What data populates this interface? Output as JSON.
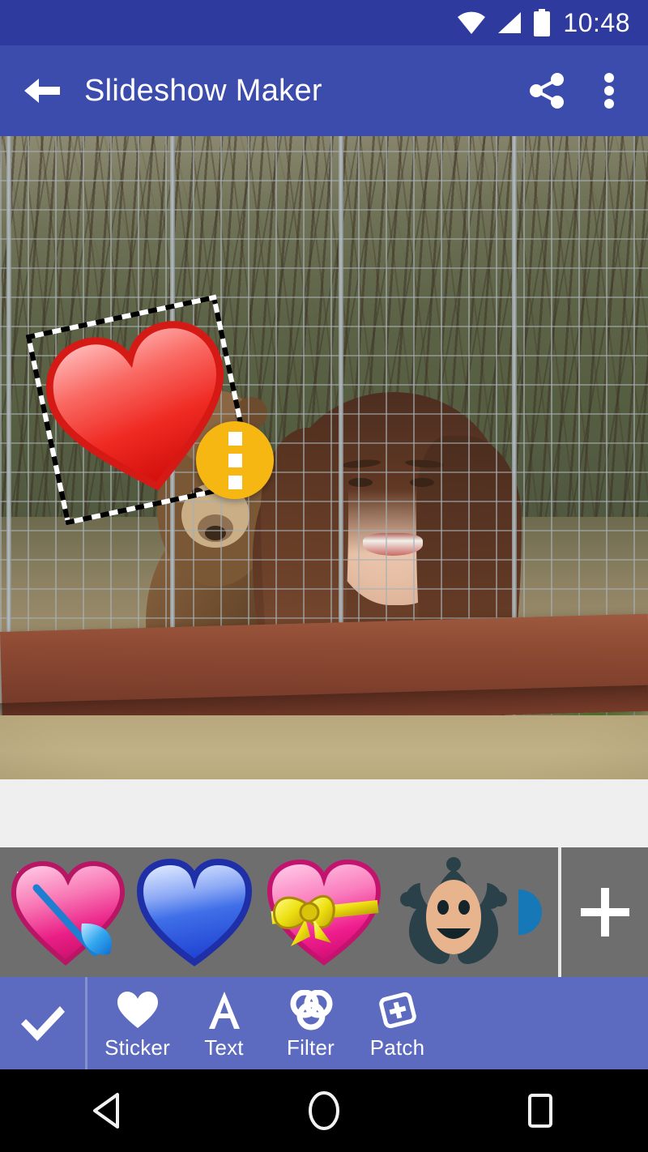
{
  "status_bar": {
    "time": "10:48",
    "icons": [
      "wifi-icon",
      "cell-signal-icon",
      "battery-icon"
    ],
    "background": "#2e3a9e"
  },
  "app_bar": {
    "title": "Slideshow Maker",
    "back_icon": "back-arrow-icon",
    "share_icon": "share-icon",
    "overflow_icon": "overflow-menu-icon",
    "background": "#3b4cad"
  },
  "canvas": {
    "description": "Photo of a smiling girl in a maroon hoodie in front of a wire fence with a brown bear behind it",
    "sticker_overlay": {
      "name": "red-heart-sticker",
      "selected": true,
      "rotation_deg": -12,
      "color": "#e8201c"
    },
    "sticker_menu_button": {
      "icon": "overflow-menu-icon",
      "color": "#f6b713"
    }
  },
  "sticker_picker": {
    "items": [
      {
        "name": "heart-with-arrow-sticker",
        "glyph": "💘"
      },
      {
        "name": "blue-heart-sticker",
        "glyph": "💙"
      },
      {
        "name": "heart-with-ribbon-sticker",
        "glyph": "💝"
      },
      {
        "name": "jester-face-sticker",
        "glyph": "🃏"
      },
      {
        "name": "blue-sticker-partial",
        "glyph": ""
      }
    ],
    "add_label": "+",
    "add_icon": "plus-icon",
    "background": "#6e6e6e"
  },
  "bottom_toolbar": {
    "done_icon": "checkmark-icon",
    "background": "#5c6bc0",
    "tools": [
      {
        "label": "Sticker",
        "icon": "heart-icon"
      },
      {
        "label": "Text",
        "icon": "letter-a-icon"
      },
      {
        "label": "Filter",
        "icon": "filter-circles-icon"
      },
      {
        "label": "Patch",
        "icon": "patch-plus-icon"
      }
    ]
  },
  "nav_bar": {
    "back_icon": "nav-back-triangle-icon",
    "home_icon": "nav-home-circle-icon",
    "recents_icon": "nav-recents-square-icon"
  }
}
